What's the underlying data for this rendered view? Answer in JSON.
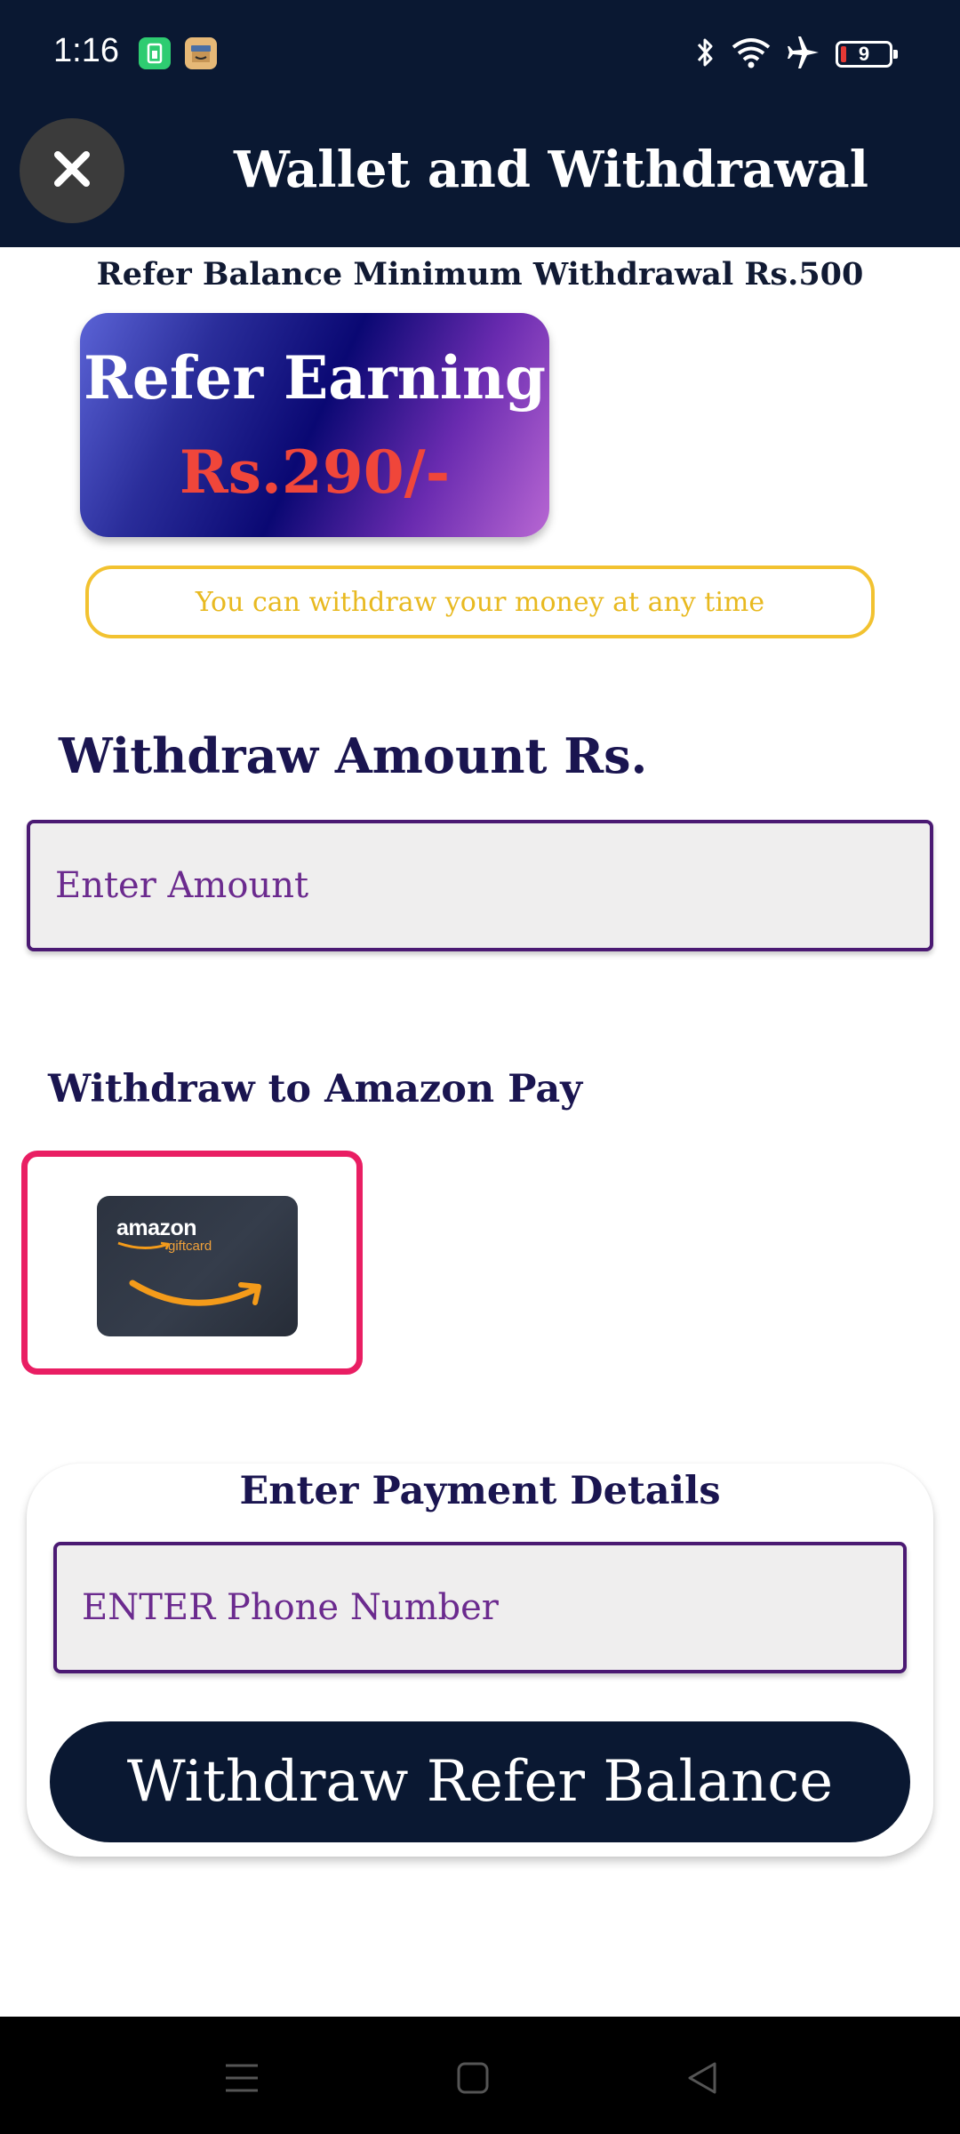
{
  "status_bar": {
    "time": "1:16",
    "battery_level": "9",
    "icons": [
      "app-notification-icon",
      "amazon-box-icon",
      "bluetooth-icon",
      "wifi-icon",
      "airplane-icon",
      "battery-icon"
    ]
  },
  "header": {
    "title": "Wallet and Withdrawal",
    "close_icon": "close-icon",
    "background_color": "#0a1832"
  },
  "notice": {
    "min_withdrawal_text": "Refer Balance Minimum Withdrawal Rs.500"
  },
  "earning_card": {
    "title": "Refer Earning",
    "amount": "Rs.290/-",
    "amount_color": "#f0463a"
  },
  "info_pill": {
    "text": "You can withdraw your money at any time",
    "accent_color": "#f2c230"
  },
  "amount_section": {
    "label": "Withdraw Amount Rs.",
    "placeholder": "Enter Amount"
  },
  "payment_method": {
    "label": "Withdraw to Amazon Pay",
    "option": {
      "brand_text": "amazon",
      "sub_text": "giftcard",
      "selected": true,
      "selected_border_color": "#e91e63"
    }
  },
  "payment_details": {
    "title": "Enter Payment Details",
    "phone_placeholder": "ENTER Phone Number",
    "submit_label": "Withdraw Refer Balance"
  },
  "nav_bar": {
    "icons": [
      "menu-icon",
      "home-icon",
      "back-icon"
    ]
  }
}
